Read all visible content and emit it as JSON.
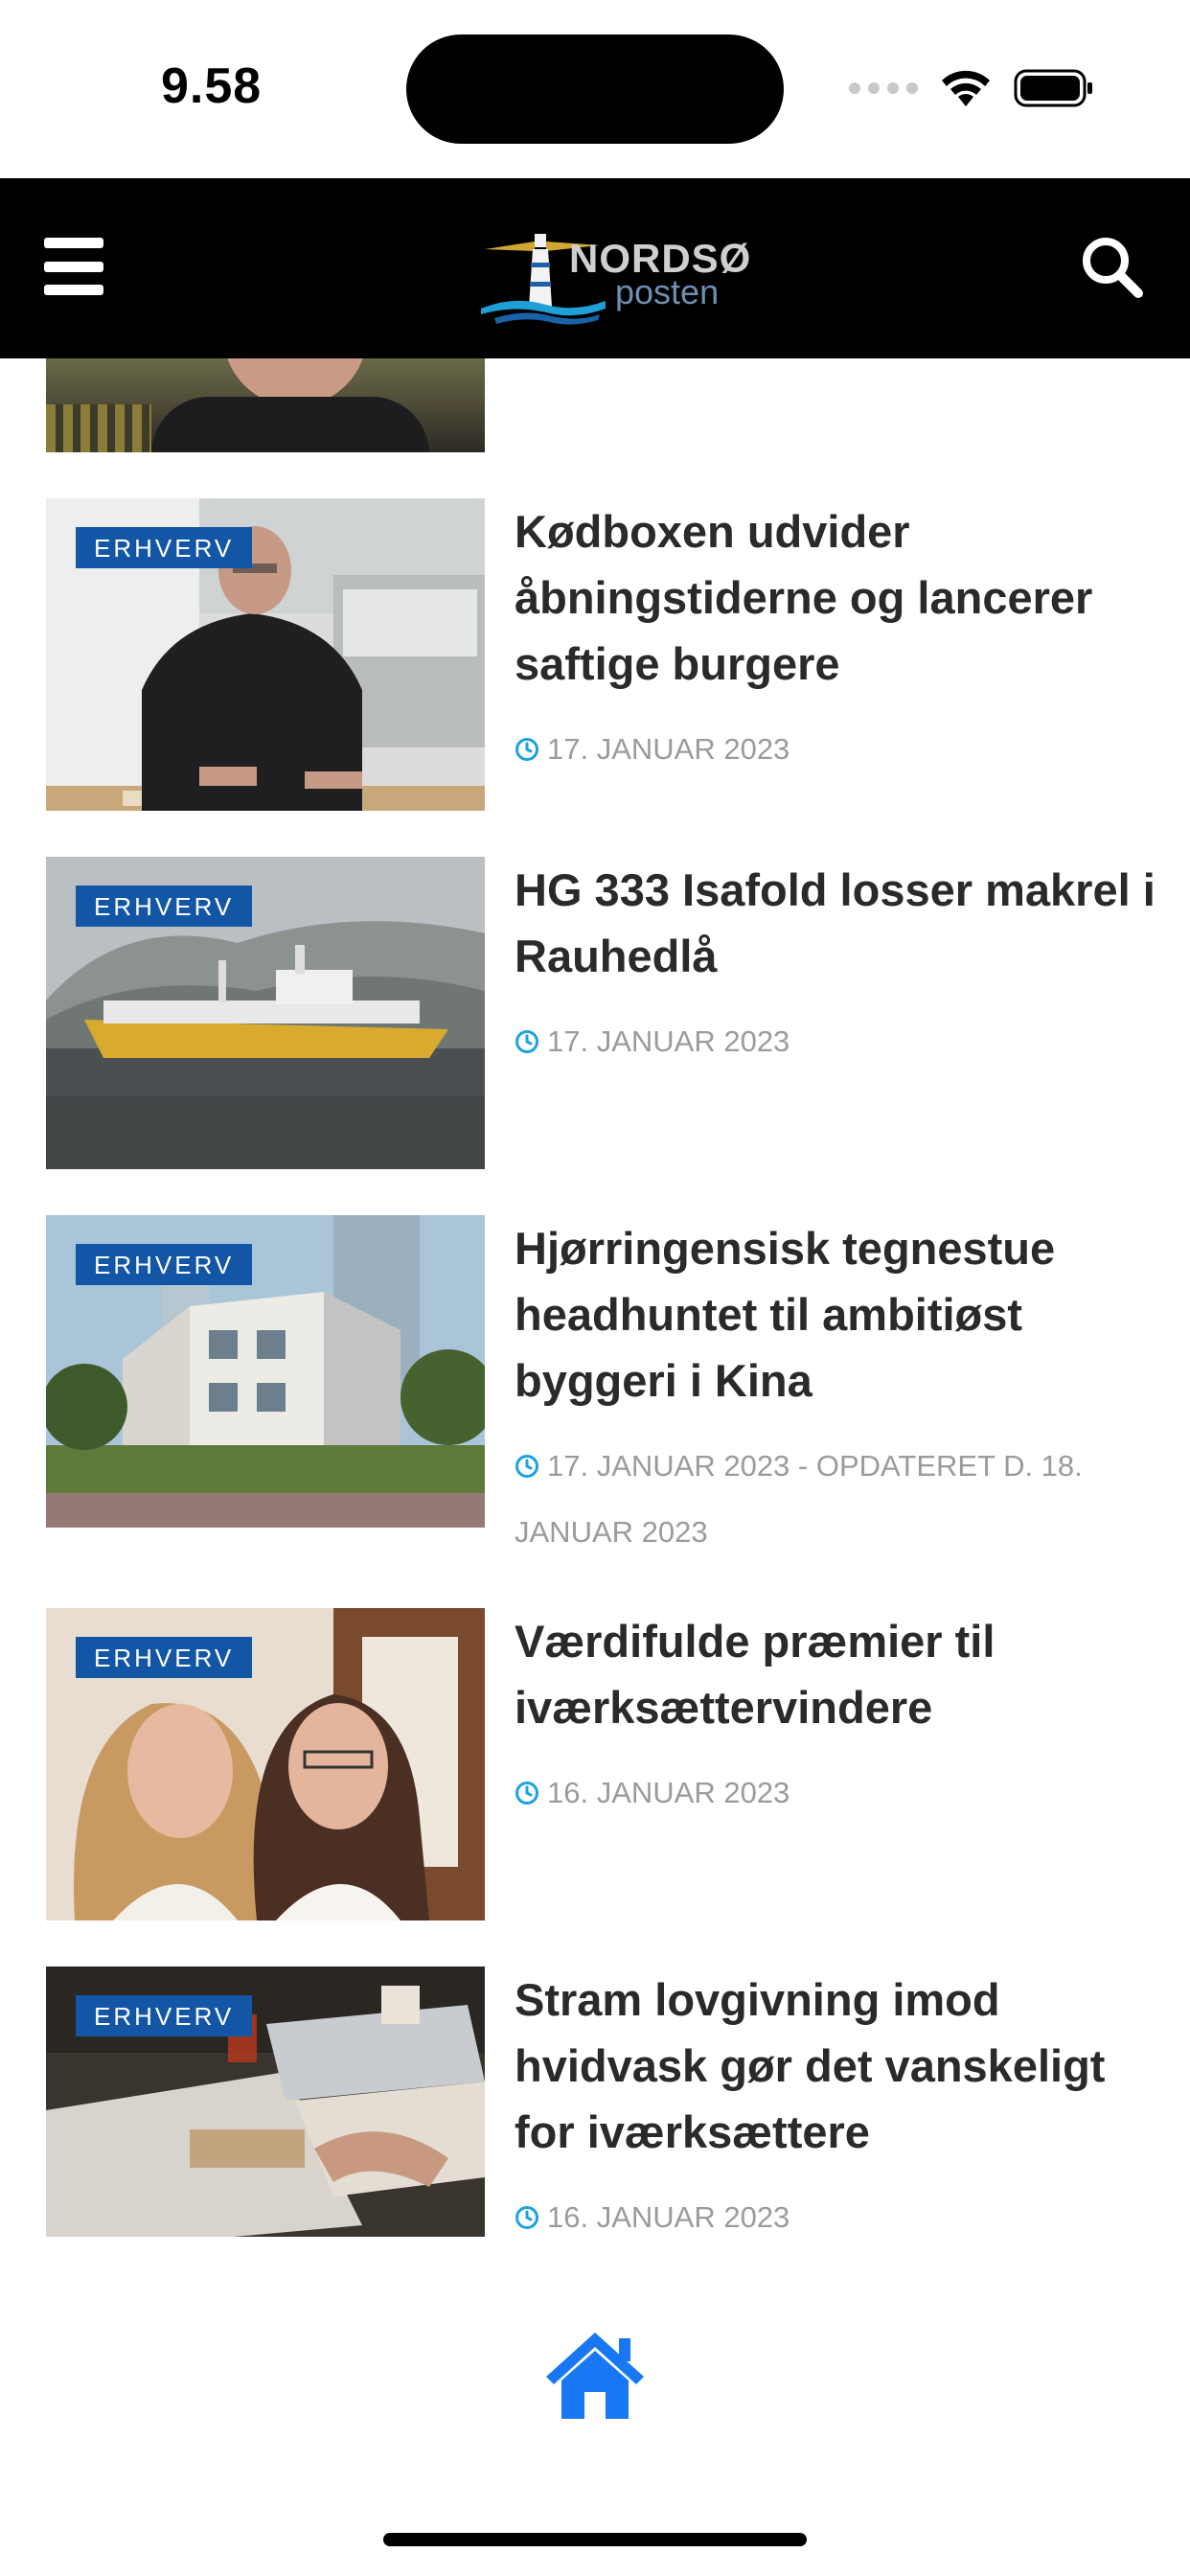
{
  "status_bar": {
    "time": "9.58"
  },
  "header": {
    "logo_text": "NORDSØ",
    "logo_subtext": "posten",
    "menu_icon": "hamburger-menu-icon",
    "search_icon": "search-icon"
  },
  "articles": [
    {
      "category": "ERHVERV",
      "title": "Kødboxen udvider åbningstiderne og lancerer saftige burgere",
      "date": "17. JANUAR 2023"
    },
    {
      "category": "ERHVERV",
      "title": "HG 333 Isafold losser makrel i Rauhedlå",
      "date": "17. JANUAR 2023"
    },
    {
      "category": "ERHVERV",
      "title": "Hjørringensisk tegnestue headhuntet til ambitiøst byggeri i Kina",
      "date": "17. JANUAR 2023 - OPDATERET D. 18. JANUAR 2023"
    },
    {
      "category": "ERHVERV",
      "title": "Værdifulde præmier til iværksættervindere",
      "date": "16. JANUAR 2023"
    },
    {
      "category": "ERHVERV",
      "title": "Stram lovgivning imod hvidvask gør det vanskeligt for iværksættere",
      "date": "16. JANUAR 2023"
    }
  ],
  "bottom_nav": {
    "home_icon": "home-icon"
  },
  "colors": {
    "header_bg": "#000000",
    "badge_bg": "#1456a6",
    "accent": "#1da1e2",
    "home_icon": "#1877f2",
    "title": "#2a2a2a",
    "meta": "#9b9b9b"
  }
}
